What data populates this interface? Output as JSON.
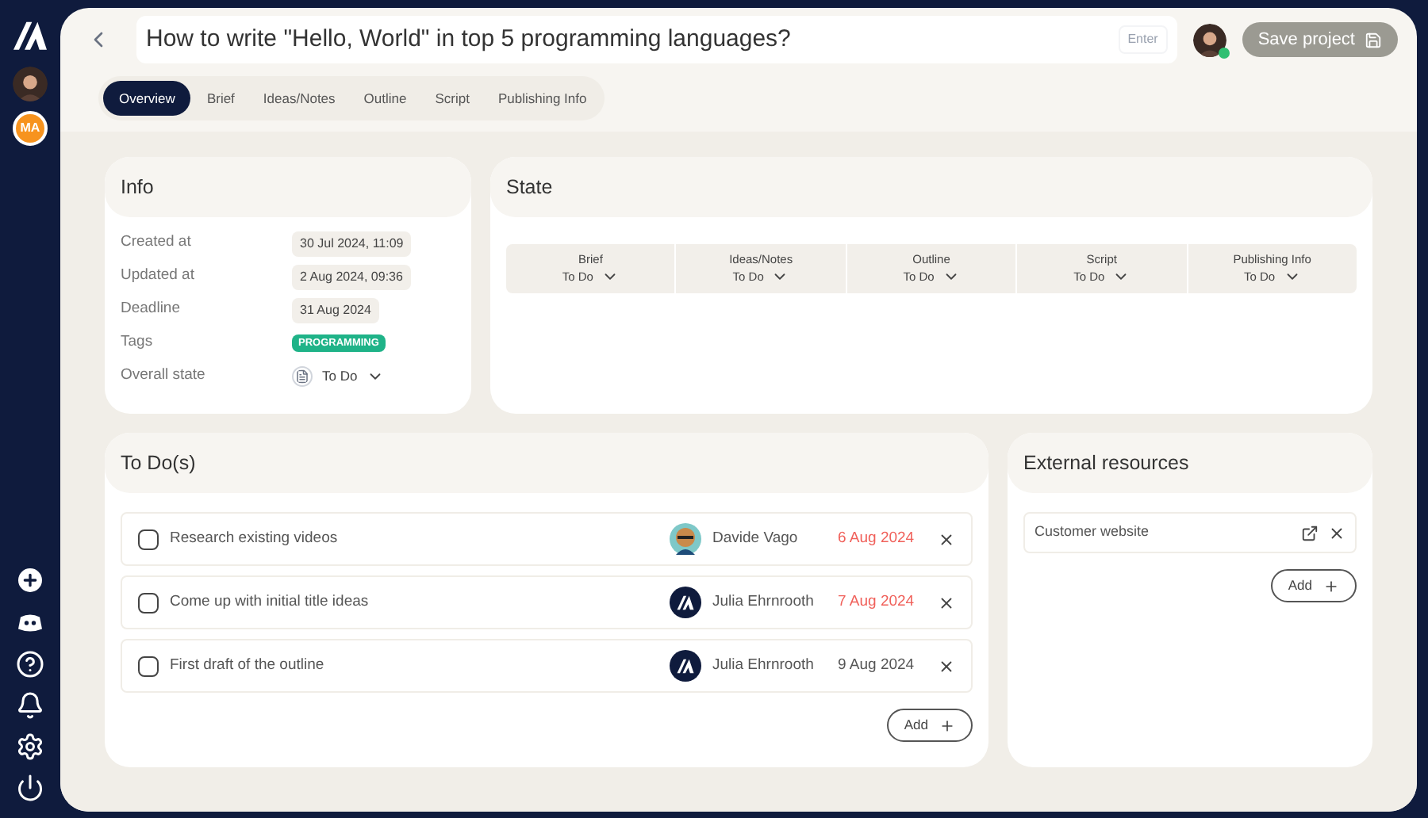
{
  "sidebar": {
    "badge": "MA"
  },
  "header": {
    "title": "How to write \"Hello, World\" in top 5 programming languages?",
    "enter_hint": "Enter",
    "save_button": "Save project"
  },
  "tabs": [
    {
      "label": "Overview",
      "selected": true
    },
    {
      "label": "Brief",
      "selected": false
    },
    {
      "label": "Ideas/Notes",
      "selected": false
    },
    {
      "label": "Outline",
      "selected": false
    },
    {
      "label": "Script",
      "selected": false
    },
    {
      "label": "Publishing Info",
      "selected": false
    }
  ],
  "info": {
    "title": "Info",
    "rows": [
      {
        "label": "Created at",
        "value": "30 Jul 2024, 11:09",
        "kind": "chip"
      },
      {
        "label": "Updated at",
        "value": "2 Aug 2024, 09:36",
        "kind": "chip"
      },
      {
        "label": "Deadline",
        "value": "31 Aug 2024",
        "kind": "chip"
      },
      {
        "label": "Tags",
        "value": "PROGRAMMING",
        "kind": "tag"
      },
      {
        "label": "Overall state",
        "value": "To Do",
        "kind": "select"
      }
    ]
  },
  "state": {
    "title": "State",
    "columns": [
      {
        "label": "Brief",
        "value": "To Do"
      },
      {
        "label": "Ideas/Notes",
        "value": "To Do"
      },
      {
        "label": "Outline",
        "value": "To Do"
      },
      {
        "label": "Script",
        "value": "To Do"
      },
      {
        "label": "Publishing Info",
        "value": "To Do"
      }
    ]
  },
  "todos": {
    "title": "To Do(s)",
    "items": [
      {
        "text": "Research existing videos",
        "checked": false,
        "assignee": "Davide Vago",
        "kind": "cartoon",
        "due": "6 Aug 2024",
        "overdue": true
      },
      {
        "text": "Come up with initial title ideas",
        "checked": false,
        "assignee": "Julia Ehrnrooth",
        "kind": "logo",
        "due": "7 Aug 2024",
        "overdue": true
      },
      {
        "text": "First draft of the outline",
        "checked": false,
        "assignee": "Julia Ehrnrooth",
        "kind": "logo",
        "due": "9 Aug 2024",
        "overdue": false
      }
    ],
    "add_button": "Add"
  },
  "resources": {
    "title": "External resources",
    "items": [
      {
        "label": "Customer website"
      }
    ],
    "add_button": "Add"
  }
}
